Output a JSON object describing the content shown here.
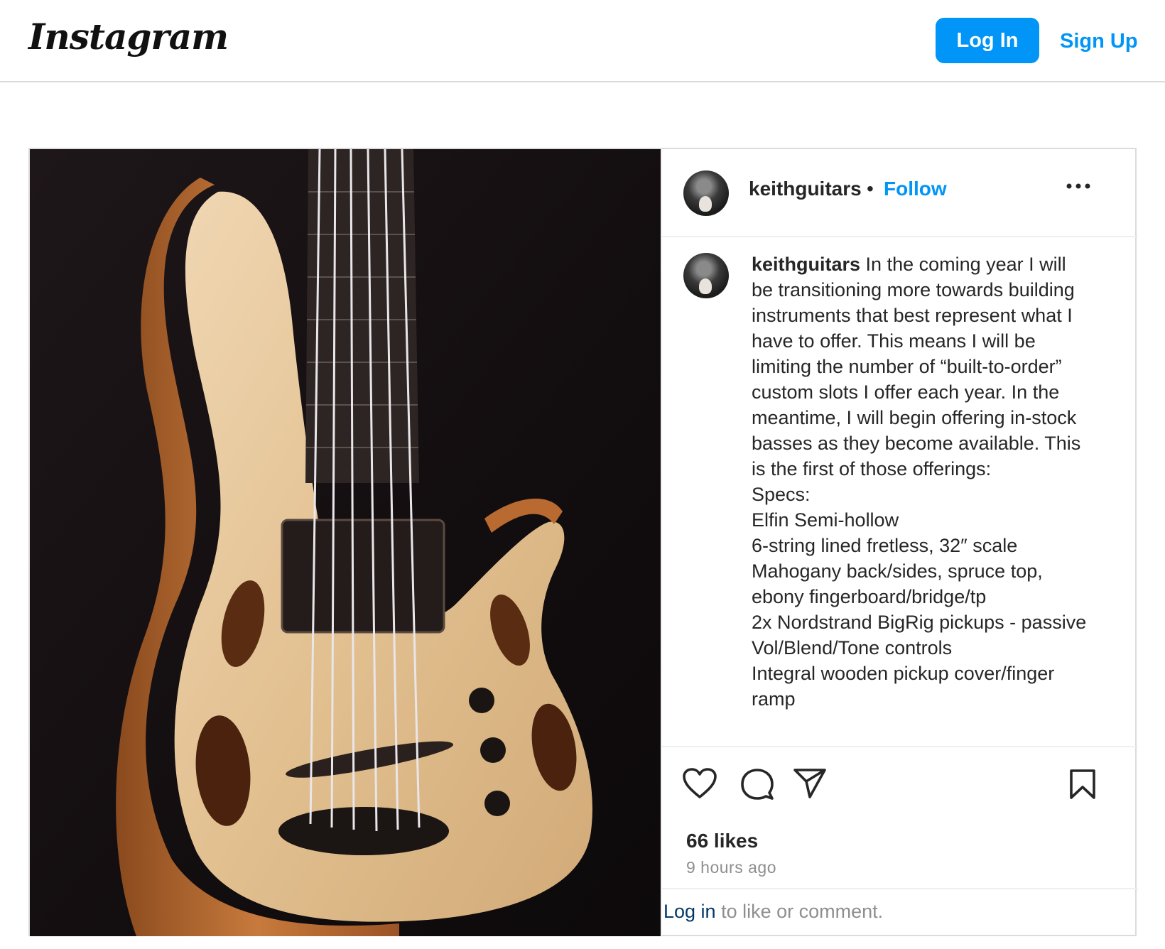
{
  "header": {
    "logo": "Instagram",
    "login_label": "Log In",
    "signup_label": "Sign Up"
  },
  "post": {
    "username": "keithguitars",
    "separator": "•",
    "follow_label": "Follow",
    "more_icon": "more-horizontal-icon",
    "caption_username": "keithguitars",
    "caption_body": " In the coming year I will be transitioning more towards building instruments that best represent what I have to offer. This means I will be limiting the number of “built-to-order” custom slots I offer each year. In the meantime, I will begin offering in-stock basses as they become available. This is the first of those offerings:\nSpecs:\nElfin Semi-hollow\n6-string lined fretless, 32″ scale\nMahogany back/sides, spruce top, ebony fingerboard/bridge/tp\n2x Nordstrand BigRig pickups - passive Vol/Blend/Tone controls\nIntegral wooden pickup cover/finger ramp",
    "likes": "66 likes",
    "time": "9 hours ago",
    "login_link": "Log in",
    "login_suffix": " to like or comment."
  },
  "icons": {
    "like": "heart-icon",
    "comment": "comment-icon",
    "share": "send-icon",
    "save": "bookmark-icon"
  },
  "colors": {
    "accent": "#0095f6",
    "text": "#262626",
    "muted": "#8e8e8e",
    "border": "#dbdbdb"
  }
}
